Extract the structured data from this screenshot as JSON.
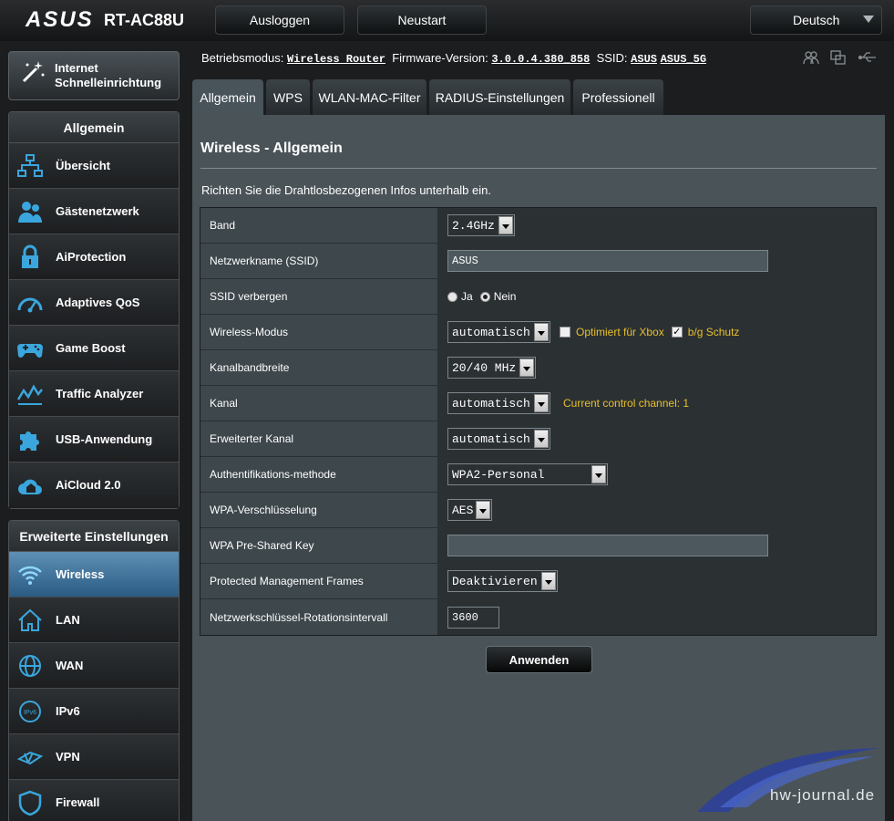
{
  "header": {
    "brand": "ASUS",
    "model": "RT-AC88U",
    "logout_label": "Ausloggen",
    "reboot_label": "Neustart",
    "language": "Deutsch"
  },
  "sidebar": {
    "quick_setup": {
      "line1": "Internet",
      "line2": "Schnelleinrichtung"
    },
    "general_heading": "Allgemein",
    "general_items": [
      {
        "label": "Übersicht",
        "icon": "network-map-icon"
      },
      {
        "label": "Gästenetzwerk",
        "icon": "guest-network-icon"
      },
      {
        "label": "AiProtection",
        "icon": "lock-icon"
      },
      {
        "label": "Adaptives QoS",
        "icon": "speedometer-icon"
      },
      {
        "label": "Game Boost",
        "icon": "gamepad-icon"
      },
      {
        "label": "Traffic Analyzer",
        "icon": "traffic-chart-icon"
      },
      {
        "label": "USB-Anwendung",
        "icon": "puzzle-icon"
      },
      {
        "label": "AiCloud 2.0",
        "icon": "cloud-home-icon"
      }
    ],
    "advanced_heading": "Erweiterte Einstellungen",
    "advanced_items": [
      {
        "label": "Wireless",
        "icon": "wifi-icon",
        "active": true
      },
      {
        "label": "LAN",
        "icon": "home-icon"
      },
      {
        "label": "WAN",
        "icon": "globe-icon"
      },
      {
        "label": "IPv6",
        "icon": "ipv6-icon"
      },
      {
        "label": "VPN",
        "icon": "vpn-icon"
      },
      {
        "label": "Firewall",
        "icon": "shield-icon"
      }
    ]
  },
  "status": {
    "mode_label": "Betriebsmodus:",
    "mode_value": "Wireless Router",
    "firmware_label": "Firmware-Version:",
    "firmware_value": "3.0.0.4.380_858",
    "ssid_label": "SSID:",
    "ssid_1": "ASUS",
    "ssid_2": "ASUS_5G"
  },
  "tabs": [
    "Allgemein",
    "WPS",
    "WLAN-MAC-Filter",
    "RADIUS-Einstellungen",
    "Professionell"
  ],
  "panel": {
    "title": "Wireless - Allgemein",
    "description": "Richten Sie die Drahtlosbezogenen Infos unterhalb ein.",
    "rows": {
      "band": {
        "label": "Band",
        "value": "2.4GHz"
      },
      "ssid": {
        "label": "Netzwerkname (SSID)",
        "value": "ASUS"
      },
      "hide_ssid": {
        "label": "SSID verbergen",
        "yes": "Ja",
        "no": "Nein"
      },
      "mode": {
        "label": "Wireless-Modus",
        "value": "automatisch",
        "xbox": "Optimiert für Xbox",
        "bg": "b/g Schutz"
      },
      "bandwidth": {
        "label": "Kanalbandbreite",
        "value": "20/40 MHz"
      },
      "channel": {
        "label": "Kanal",
        "value": "automatisch",
        "note": "Current control channel: 1"
      },
      "ext_channel": {
        "label": "Erweiterter Kanal",
        "value": "automatisch"
      },
      "auth": {
        "label": "Authentifikations-methode",
        "value": "WPA2-Personal"
      },
      "encryption": {
        "label": "WPA-Verschlüsselung",
        "value": "AES"
      },
      "psk": {
        "label": "WPA Pre-Shared Key",
        "value": ""
      },
      "pmf": {
        "label": "Protected Management Frames",
        "value": "Deaktivieren"
      },
      "rotation": {
        "label": "Netzwerkschlüssel-Rotationsintervall",
        "value": "3600"
      }
    },
    "apply_label": "Anwenden"
  },
  "watermark": "hw-journal.de"
}
